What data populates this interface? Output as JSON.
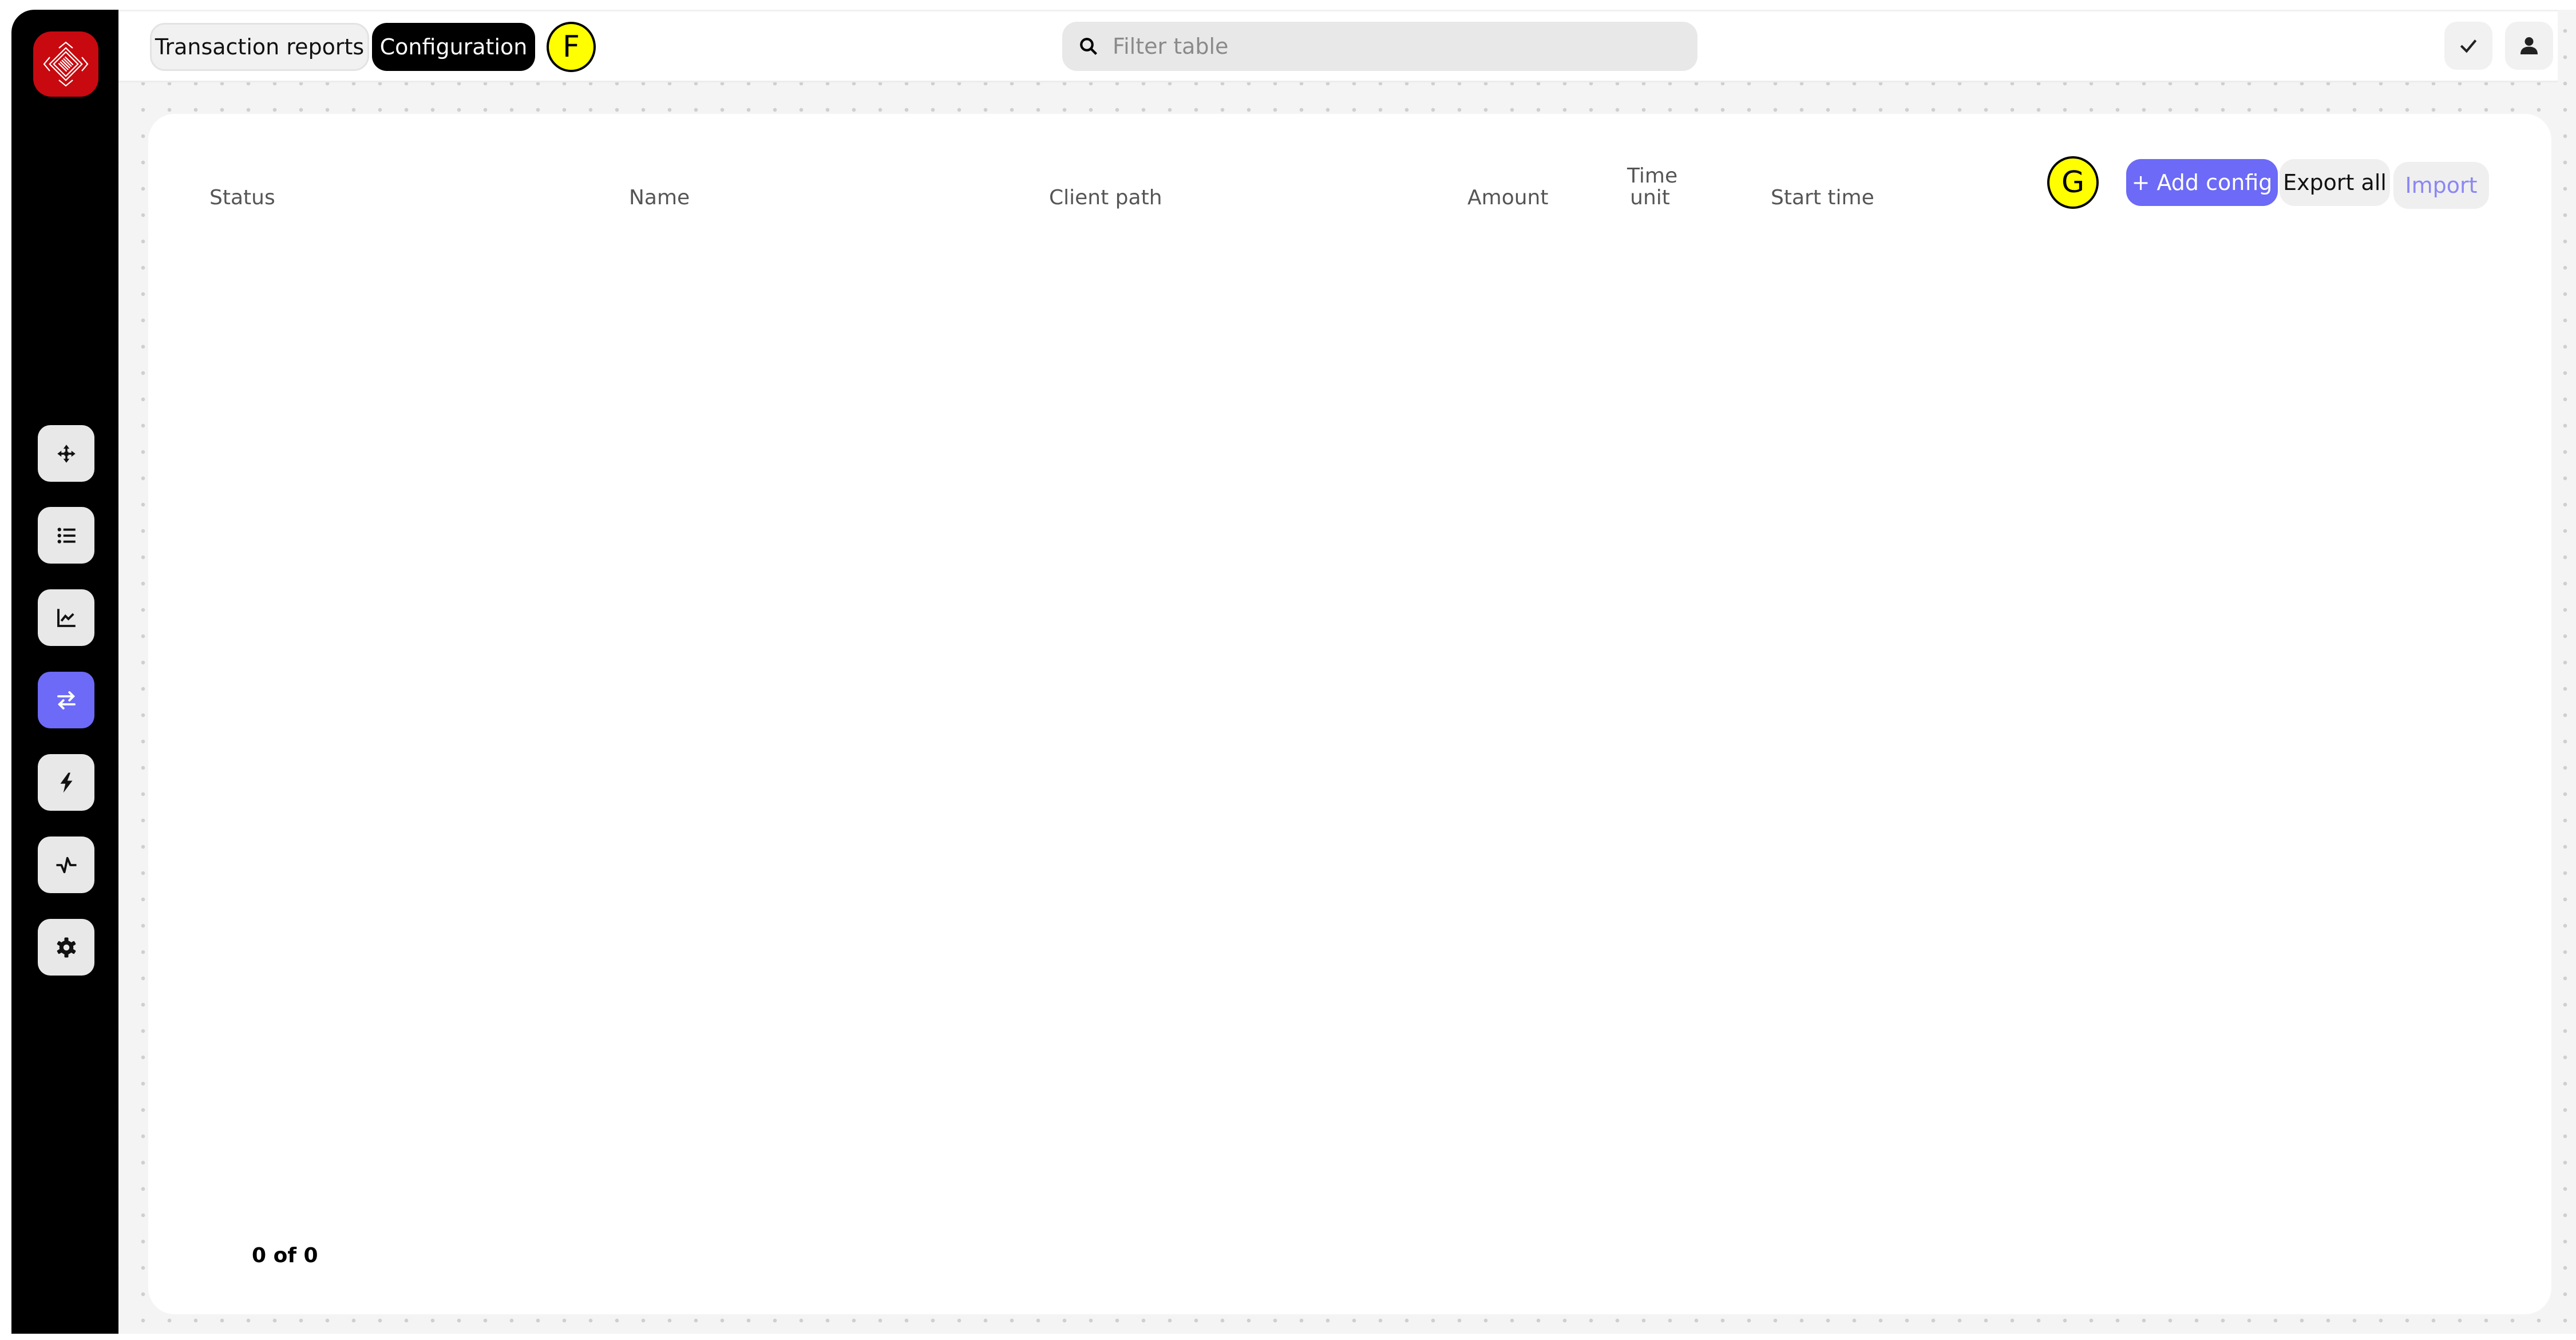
{
  "app": {
    "logo": "app-logo"
  },
  "sidebar": {
    "items": [
      {
        "name": "move",
        "icon": "move-arrows-icon",
        "active": false
      },
      {
        "name": "list",
        "icon": "list-icon",
        "active": false
      },
      {
        "name": "chart",
        "icon": "line-chart-icon",
        "active": false
      },
      {
        "name": "transactions",
        "icon": "transfer-arrows-icon",
        "active": true
      },
      {
        "name": "bolt",
        "icon": "lightning-icon",
        "active": false
      },
      {
        "name": "activity",
        "icon": "pulse-icon",
        "active": false
      },
      {
        "name": "settings",
        "icon": "gear-icon",
        "active": false
      }
    ]
  },
  "header": {
    "tabs": [
      {
        "label": "Transaction reports",
        "active": false
      },
      {
        "label": "Configuration",
        "active": true
      }
    ],
    "annotation_f": "F",
    "search": {
      "placeholder": "Filter table",
      "value": ""
    },
    "check_icon": "check-icon",
    "user_icon": "user-icon"
  },
  "table": {
    "columns": [
      {
        "label": "Status"
      },
      {
        "label": "Name"
      },
      {
        "label": "Client path"
      },
      {
        "label": "Amount"
      },
      {
        "label": "Time unit"
      },
      {
        "label": "Start time"
      }
    ],
    "rows": [],
    "annotation_g": "G",
    "actions": {
      "add_config": "+ Add config",
      "export_all": "Export all",
      "import": "Import"
    },
    "pagination": "0 of 0"
  },
  "colors": {
    "accent": "#6c6af6",
    "logo_red": "#c8090f",
    "sidebar_bg": "#000000",
    "annotation_yellow": "#ffff00"
  }
}
